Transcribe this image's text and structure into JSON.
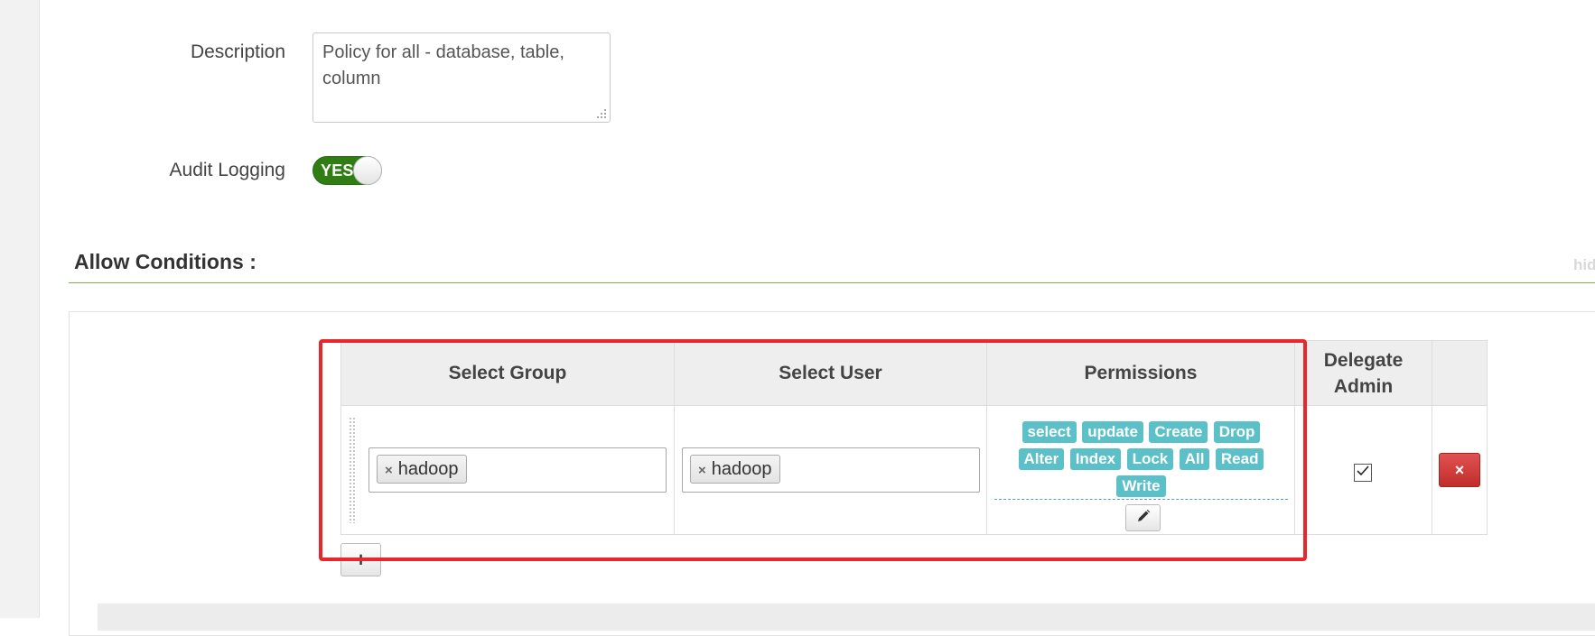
{
  "form": {
    "description_label": "Description",
    "description_value": "Policy for all - database, table, column",
    "audit_logging_label": "Audit Logging",
    "audit_logging_toggle": "YES"
  },
  "allow_conditions": {
    "title": "Allow Conditions :",
    "hide_link": "hid",
    "columns": {
      "group": "Select Group",
      "user": "Select User",
      "permissions": "Permissions",
      "delegate_admin": "Delegate Admin"
    },
    "row": {
      "group_chip": "hadoop",
      "group_chip_remove": "×",
      "user_chip": "hadoop",
      "user_chip_remove": "×",
      "permissions": [
        "select",
        "update",
        "Create",
        "Drop",
        "Alter",
        "Index",
        "Lock",
        "All",
        "Read",
        "Write"
      ],
      "delegate_admin_checked": true,
      "delete_label": "×"
    },
    "add_button_label": "+"
  },
  "colors": {
    "toggle_on": "#2f7d13",
    "permission_tag": "#5bc0c8",
    "delete_button": "#c12e2a",
    "section_rule": "#7ab648",
    "highlight_box": "#e8262b"
  }
}
